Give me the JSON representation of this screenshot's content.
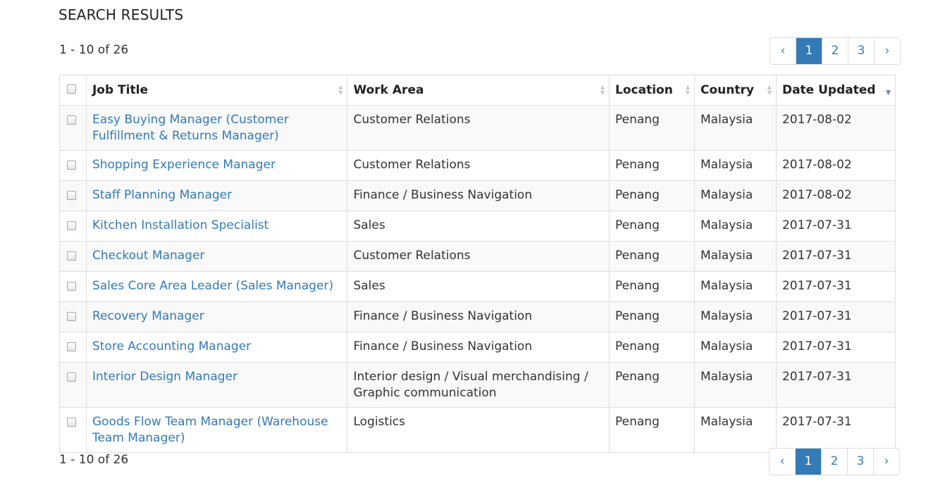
{
  "heading": "SEARCH RESULTS",
  "count_text": "1 - 10 of 26",
  "pagination": {
    "prev": "‹",
    "next": "›",
    "pages": [
      "1",
      "2",
      "3"
    ],
    "active": "1"
  },
  "table": {
    "headers": {
      "job_title": "Job Title",
      "work_area": "Work Area",
      "location": "Location",
      "country": "Country",
      "date_updated": "Date Updated"
    },
    "sort": {
      "column": "date_updated",
      "direction": "descending"
    },
    "rows": [
      {
        "job_title": "Easy Buying Manager (Customer Fulfillment & Returns Manager)",
        "work_area": "Customer Relations",
        "location": "Penang",
        "country": "Malaysia",
        "date_updated": "2017-08-02"
      },
      {
        "job_title": "Shopping Experience Manager",
        "work_area": "Customer Relations",
        "location": "Penang",
        "country": "Malaysia",
        "date_updated": "2017-08-02"
      },
      {
        "job_title": "Staff Planning Manager",
        "work_area": "Finance / Business Navigation",
        "location": "Penang",
        "country": "Malaysia",
        "date_updated": "2017-08-02"
      },
      {
        "job_title": "Kitchen Installation Specialist",
        "work_area": "Sales",
        "location": "Penang",
        "country": "Malaysia",
        "date_updated": "2017-07-31"
      },
      {
        "job_title": "Checkout Manager",
        "work_area": "Customer Relations",
        "location": "Penang",
        "country": "Malaysia",
        "date_updated": "2017-07-31"
      },
      {
        "job_title": "Sales Core Area Leader (Sales Manager)",
        "work_area": "Sales",
        "location": "Penang",
        "country": "Malaysia",
        "date_updated": "2017-07-31"
      },
      {
        "job_title": "Recovery Manager",
        "work_area": "Finance / Business Navigation",
        "location": "Penang",
        "country": "Malaysia",
        "date_updated": "2017-07-31"
      },
      {
        "job_title": "Store Accounting Manager",
        "work_area": "Finance / Business Navigation",
        "location": "Penang",
        "country": "Malaysia",
        "date_updated": "2017-07-31"
      },
      {
        "job_title": "Interior Design Manager",
        "work_area": "Interior design / Visual merchandising / Graphic communication",
        "location": "Penang",
        "country": "Malaysia",
        "date_updated": "2017-07-31"
      },
      {
        "job_title": "Goods Flow Team Manager (Warehouse Team Manager)",
        "work_area": "Logistics",
        "location": "Penang",
        "country": "Malaysia",
        "date_updated": "2017-07-31"
      }
    ]
  },
  "colors": {
    "link": "#337ab7",
    "active_page_bg": "#337ab7",
    "border": "#dddddd",
    "stripe": "#f9f9f9"
  }
}
